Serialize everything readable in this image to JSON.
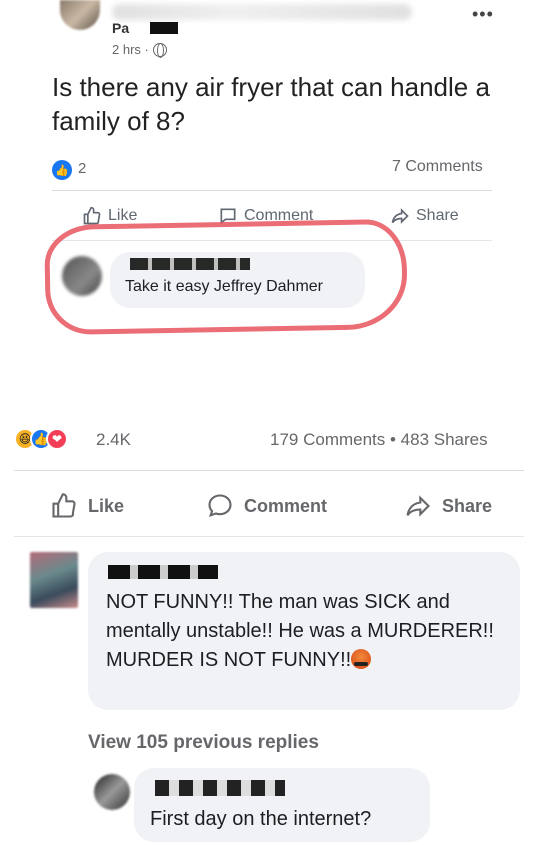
{
  "embedded_post": {
    "author": "Pa",
    "time": "2 hrs ·",
    "text": "Is there any air fryer that can handle a family of 8?",
    "like_count": "2",
    "comments": "7 Comments",
    "actions": {
      "like": "Like",
      "comment": "Comment",
      "share": "Share"
    },
    "reply": {
      "text": "Take it easy Jeffrey Dahmer"
    }
  },
  "outer_post": {
    "reaction_count": "2.4K",
    "stats": "179 Comments • 483 Shares",
    "actions": {
      "like": "Like",
      "comment": "Comment",
      "share": "Share"
    }
  },
  "comments": [
    {
      "text": "NOT FUNNY!! The man was SICK and mentally unstable!! He was a MURDERER!! MURDER IS NOT FUNNY!!"
    },
    {
      "text": "First day on the internet?"
    }
  ],
  "view_replies": "View 105 previous replies",
  "icons": {
    "like": "thumbs-up-icon",
    "comment": "speech-bubble-icon",
    "share": "share-arrow-icon",
    "globe": "globe-icon",
    "more": "more-dots-icon"
  },
  "colors": {
    "facebook_blue": "#1877f2",
    "annotation_red": "#e8535e",
    "bubble_gray": "#f0f2f5"
  }
}
